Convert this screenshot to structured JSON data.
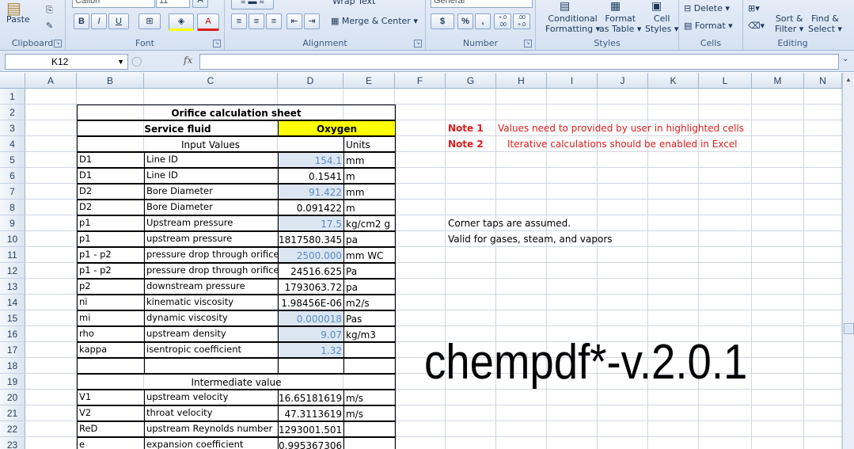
{
  "ribbon": {
    "clipboard": {
      "label": "Clipboard",
      "paste": "Paste"
    },
    "font": {
      "label": "Font",
      "name": "Calibri",
      "size": "11",
      "bold": "B",
      "italic": "I",
      "underline": "U",
      "grow": "A",
      "shrink": "A",
      "color": "A"
    },
    "alignment": {
      "label": "Alignment",
      "wrap": "Wrap Text",
      "merge": "Merge & Center"
    },
    "number": {
      "label": "Number",
      "format": "General",
      "currency": "$",
      "percent": "%",
      "comma": ",",
      "inc": "+.0 .00",
      "dec": ".00 +.0"
    },
    "styles": {
      "label": "Styles",
      "conditional": "Conditional",
      "conditional2": "Formatting",
      "format_table": "Format",
      "format_table2": "as Table",
      "cell_styles": "Cell",
      "cell_styles2": "Styles"
    },
    "cells": {
      "label": "Cells",
      "delete": "Delete",
      "format": "Format"
    },
    "editing": {
      "label": "Editing",
      "sort": "Sort &",
      "sort2": "Filter",
      "find": "Find &",
      "find2": "Select"
    }
  },
  "formula_bar": {
    "name_box": "K12",
    "fx": "fx",
    "content": ""
  },
  "columns": [
    "A",
    "B",
    "C",
    "D",
    "E",
    "F",
    "G",
    "H",
    "I",
    "J",
    "K",
    "L",
    "M",
    "N"
  ],
  "rows": [
    "1",
    "2",
    "3",
    "4",
    "5",
    "6",
    "7",
    "8",
    "9",
    "10",
    "11",
    "12",
    "13",
    "14",
    "15",
    "16",
    "17",
    "18",
    "19",
    "20",
    "21",
    "22",
    "23"
  ],
  "sheet": {
    "title": "Orifice calculation sheet",
    "service_label": "Service fluid",
    "service_value": "Oxygen",
    "input_header": "Input Values",
    "units_header": "Units",
    "inputs": [
      {
        "sym": "D1",
        "desc": "Line ID",
        "val": "154.1",
        "unit": "mm",
        "input": true
      },
      {
        "sym": "D1",
        "desc": "Line ID",
        "val": "0.1541",
        "unit": "m",
        "input": false
      },
      {
        "sym": "D2",
        "desc": "Bore Diameter",
        "val": "91.422",
        "unit": "mm",
        "input": true
      },
      {
        "sym": "D2",
        "desc": "Bore Diameter",
        "val": "0.091422",
        "unit": "m",
        "input": false
      },
      {
        "sym": "p1",
        "desc": "Upstream pressure",
        "val": "17.5",
        "unit": "kg/cm2 g",
        "input": true
      },
      {
        "sym": "p1",
        "desc": "upstream pressure",
        "val": "1817580.345",
        "unit": "pa",
        "input": false
      },
      {
        "sym": "p1 - p2",
        "desc": "pressure drop through orifice",
        "val": "2500.000",
        "unit": "mm WC",
        "input": true
      },
      {
        "sym": "p1 - p2",
        "desc": "pressure drop through orifice",
        "val": "24516.625",
        "unit": "Pa",
        "input": false
      },
      {
        "sym": "p2",
        "desc": "downstream pressure",
        "val": "1793063.72",
        "unit": "pa",
        "input": false
      },
      {
        "sym": "ni",
        "desc": "kinematic viscosity",
        "val": "1.98456E-06",
        "unit": "m2/s",
        "input": false
      },
      {
        "sym": "mi",
        "desc": "dynamic viscosity",
        "val": "0.000018",
        "unit": "Pas",
        "input": true
      },
      {
        "sym": "rho",
        "desc": "upstream density",
        "val": "9.07",
        "unit": "kg/m3",
        "input": true
      },
      {
        "sym": "kappa",
        "desc": "isentropic coefficient",
        "val": "1.32",
        "unit": "",
        "input": true
      }
    ],
    "intermediate_header": "Intermediate value",
    "intermediate": [
      {
        "sym": "V1",
        "desc": "upstream velocity",
        "val": "16.65181619",
        "unit": "m/s"
      },
      {
        "sym": "V2",
        "desc": "throat velocity",
        "val": "47.3113619",
        "unit": "m/s"
      },
      {
        "sym": "ReD",
        "desc": "upstream Reynolds number",
        "val": "1293001.501",
        "unit": ""
      },
      {
        "sym": "e",
        "desc": "expansion coefficient",
        "val": "0.995367306",
        "unit": ""
      }
    ],
    "note1_label": "Note 1",
    "note1_text": "Values need to provided by user in highlighted cells",
    "note2_label": "Note 2",
    "note2_text": "Iterative calculations should be enabled in Excel",
    "corner_taps": "Corner taps are assumed.",
    "valid_for": "Valid for gases, steam, and vapors",
    "watermark": "chempdf*-v.2.0.1"
  },
  "colors": {
    "highlight_yellow": "#ffff00",
    "input_fill": "#dce6f2",
    "input_text": "#5a8ac6",
    "note_red": "#e01b1b"
  }
}
